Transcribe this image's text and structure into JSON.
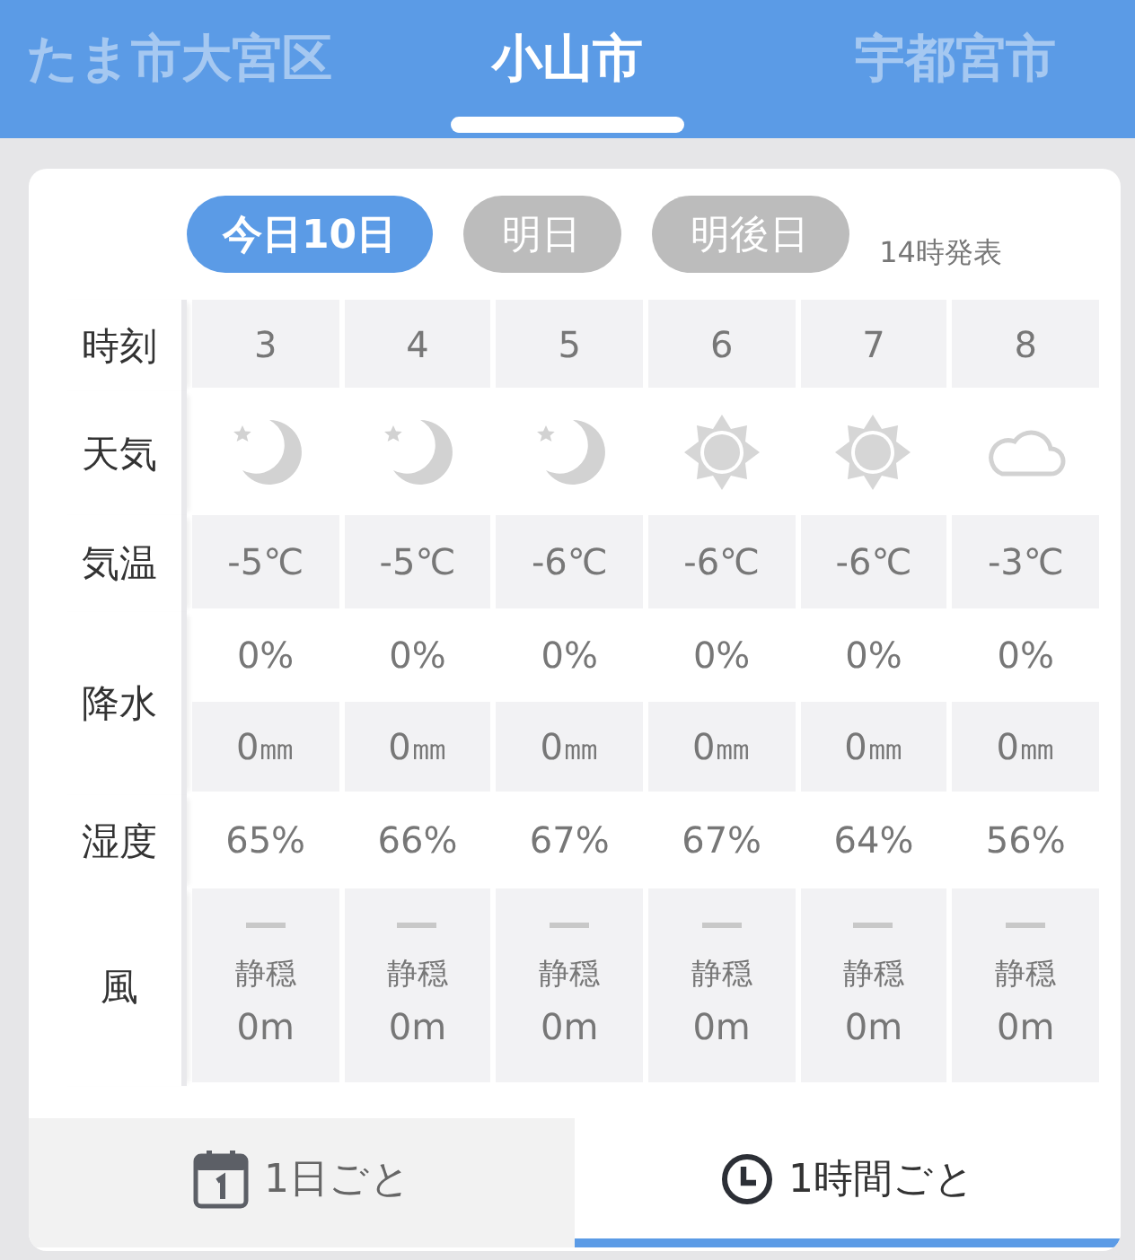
{
  "city_tabs": [
    {
      "label": "たま市大宮区",
      "selected": false
    },
    {
      "label": "小山市",
      "selected": true
    },
    {
      "label": "宇都宮市",
      "selected": false
    }
  ],
  "day_tabs": [
    {
      "label": "今日10日",
      "selected": true
    },
    {
      "label": "明日",
      "selected": false
    },
    {
      "label": "明後日",
      "selected": false
    }
  ],
  "issued": "14時発表",
  "table": {
    "row_headers": {
      "time": "時刻",
      "weather": "天気",
      "temp": "気温",
      "precip": "降水",
      "humidity": "湿度",
      "wind": "風"
    },
    "hours": [
      {
        "time": "3",
        "kind": "moon",
        "temp": "-5℃",
        "precip_chance": "0%",
        "precip_amount": "0㎜",
        "humidity": "65%",
        "wind": "静穏",
        "wind_speed": "0m"
      },
      {
        "time": "4",
        "kind": "moon",
        "temp": "-5℃",
        "precip_chance": "0%",
        "precip_amount": "0㎜",
        "humidity": "66%",
        "wind": "静穏",
        "wind_speed": "0m"
      },
      {
        "time": "5",
        "kind": "moon",
        "temp": "-6℃",
        "precip_chance": "0%",
        "precip_amount": "0㎜",
        "humidity": "67%",
        "wind": "静穏",
        "wind_speed": "0m"
      },
      {
        "time": "6",
        "kind": "sun",
        "temp": "-6℃",
        "precip_chance": "0%",
        "precip_amount": "0㎜",
        "humidity": "67%",
        "wind": "静穏",
        "wind_speed": "0m"
      },
      {
        "time": "7",
        "kind": "sun",
        "temp": "-6℃",
        "precip_chance": "0%",
        "precip_amount": "0㎜",
        "humidity": "64%",
        "wind": "静穏",
        "wind_speed": "0m"
      },
      {
        "time": "8",
        "kind": "cloud",
        "temp": "-3℃",
        "precip_chance": "0%",
        "precip_amount": "0㎜",
        "humidity": "56%",
        "wind": "静穏",
        "wind_speed": "0m"
      }
    ]
  },
  "view_tabs": [
    {
      "label": "1日ごと",
      "kind": "calendar",
      "selected": false
    },
    {
      "label": "1時間ごと",
      "kind": "clock",
      "selected": true
    }
  ]
}
